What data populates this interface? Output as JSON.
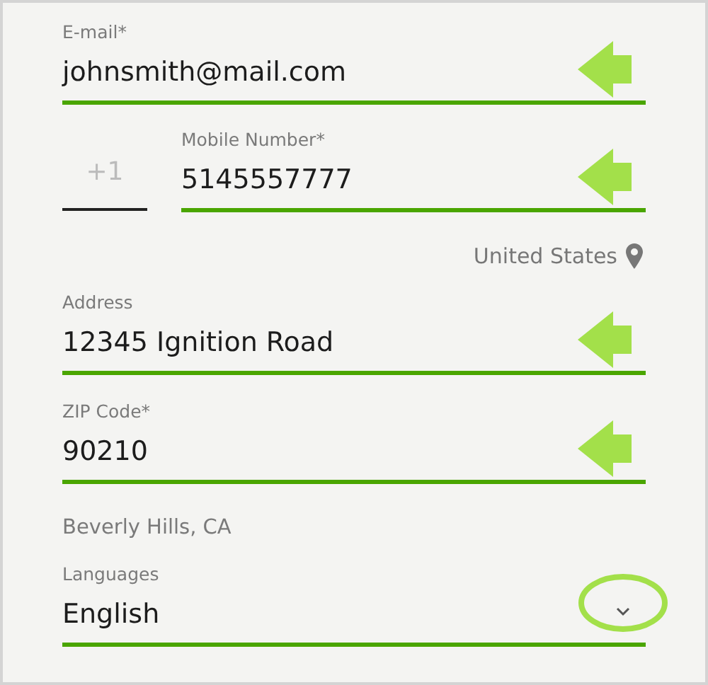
{
  "email": {
    "label": "E-mail*",
    "value": "johnsmith@mail.com",
    "arrow": true
  },
  "phone": {
    "country_code": {
      "placeholder": "+1"
    },
    "label": "Mobile Number*",
    "value": "5145557777",
    "arrow": true
  },
  "country": "United States",
  "address": {
    "label": "Address",
    "value": "12345 Ignition Road",
    "arrow": true
  },
  "zip": {
    "label": "ZIP Code*",
    "value": "90210",
    "arrow": true
  },
  "city": "Beverly Hills, CA",
  "languages": {
    "label": "Languages",
    "value": "English",
    "kind": "select",
    "circled": true
  }
}
